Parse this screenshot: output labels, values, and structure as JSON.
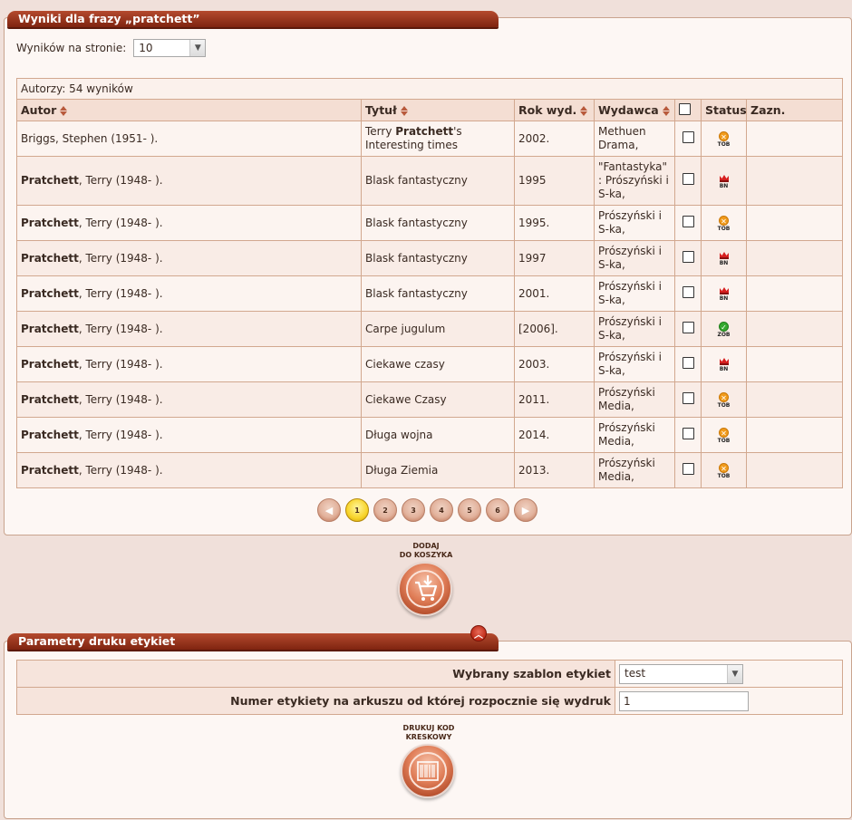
{
  "results_panel": {
    "title": "Wyniki dla frazy „pratchett”",
    "per_page_label": "Wyników na stronie:",
    "per_page_value": "10",
    "caption": "Autorzy: 54 wyników",
    "columns": [
      "Autor",
      "Tytuł",
      "Rok wyd.",
      "Wydawca",
      "",
      "Status",
      "Zazn."
    ],
    "rows": [
      {
        "author_bold": "",
        "author_rest": "Briggs, Stephen (1951- ).",
        "title_pre": "Terry ",
        "title_bold": "Pratchett",
        "title_post": "'s Interesting times",
        "year": "2002.",
        "publisher": "Methuen Drama,",
        "status": "TOB"
      },
      {
        "author_bold": "Pratchett",
        "author_rest": ", Terry (1948- ).",
        "title_pre": "Blask fantastyczny",
        "title_bold": "",
        "title_post": "",
        "year": "1995",
        "publisher": "\"Fantastyka\" : Prószyński i S-ka,",
        "status": "BN"
      },
      {
        "author_bold": "Pratchett",
        "author_rest": ", Terry (1948- ).",
        "title_pre": "Blask fantastyczny",
        "title_bold": "",
        "title_post": "",
        "year": "1995.",
        "publisher": "Prószyński i S-ka,",
        "status": "TOB"
      },
      {
        "author_bold": "Pratchett",
        "author_rest": ", Terry (1948- ).",
        "title_pre": "Blask fantastyczny",
        "title_bold": "",
        "title_post": "",
        "year": "1997",
        "publisher": "Prószyński i S-ka,",
        "status": "BN"
      },
      {
        "author_bold": "Pratchett",
        "author_rest": ", Terry (1948- ).",
        "title_pre": "Blask fantastyczny",
        "title_bold": "",
        "title_post": "",
        "year": "2001.",
        "publisher": "Prószyński i S-ka,",
        "status": "BN"
      },
      {
        "author_bold": "Pratchett",
        "author_rest": ", Terry (1948- ).",
        "title_pre": "Carpe jugulum",
        "title_bold": "",
        "title_post": "",
        "year": "[2006].",
        "publisher": "Prószyński i S-ka,",
        "status": "ZOB"
      },
      {
        "author_bold": "Pratchett",
        "author_rest": ", Terry (1948- ).",
        "title_pre": "Ciekawe czasy",
        "title_bold": "",
        "title_post": "",
        "year": "2003.",
        "publisher": "Prószyński i S-ka,",
        "status": "BN"
      },
      {
        "author_bold": "Pratchett",
        "author_rest": ", Terry (1948- ).",
        "title_pre": "Ciekawe Czasy",
        "title_bold": "",
        "title_post": "",
        "year": "2011.",
        "publisher": "Prószyński Media,",
        "status": "TOB"
      },
      {
        "author_bold": "Pratchett",
        "author_rest": ", Terry (1948- ).",
        "title_pre": "Długa wojna",
        "title_bold": "",
        "title_post": "",
        "year": "2014.",
        "publisher": "Prószyński Media,",
        "status": "TOB"
      },
      {
        "author_bold": "Pratchett",
        "author_rest": ", Terry (1948- ).",
        "title_pre": "Długa Ziemia",
        "title_bold": "",
        "title_post": "",
        "year": "2013.",
        "publisher": "Prószyński Media,",
        "status": "TOB"
      }
    ],
    "pagination": {
      "pages": [
        "1",
        "2",
        "3",
        "4",
        "5",
        "6"
      ],
      "current": "1"
    },
    "add_to_cart_label_1": "DODAJ",
    "add_to_cart_label_2": "DO KOSZYKA"
  },
  "labels_panel": {
    "title": "Parametry druku etykiet",
    "template_label": "Wybrany szablon etykiet",
    "template_value": "test",
    "start_label": "Numer etykiety na arkuszu od której rozpocznie się wydruk",
    "start_value": "1",
    "print_label_1": "DRUKUJ KOD",
    "print_label_2": "KRESKOWY"
  },
  "status_icons": {
    "TOB": {
      "icon": "x-circle-icon",
      "color": "#f19b1c"
    },
    "ZOB": {
      "icon": "check-circle-icon",
      "color": "#35a92f"
    },
    "BN": {
      "icon": "crown-icon",
      "color": "#d62020"
    }
  }
}
